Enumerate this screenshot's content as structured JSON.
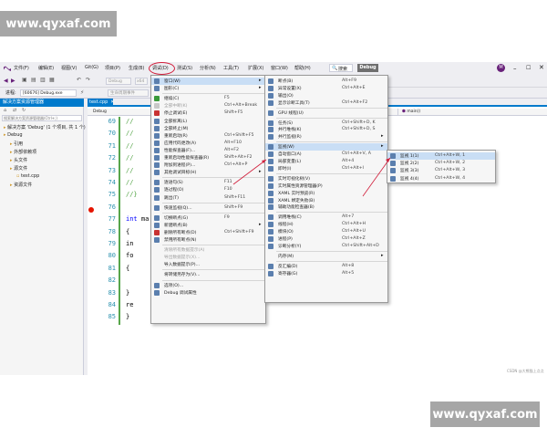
{
  "watermark": {
    "text": "www.qyxaf.com"
  },
  "menubar": {
    "items": [
      "文件(F)",
      "编辑(E)",
      "视图(V)",
      "Git(G)",
      "项目(P)",
      "生成(B)",
      "调试(D)",
      "测试(S)",
      "分析(N)",
      "工具(T)",
      "扩展(X)",
      "窗口(W)",
      "帮助(H)"
    ],
    "search_label": "搜索",
    "solution_badge": "Debug",
    "avatar_letter": "M",
    "live_share_label": "Live Share"
  },
  "toolbar": {
    "config": "Debug",
    "platform": "x64",
    "process_label": "进程:",
    "process_value": "[60676] Debug.exe",
    "lifecycle_label": "生命周期事件"
  },
  "solution_explorer": {
    "title": "解决方案资源管理器",
    "search_placeholder": "搜索解决方案资源管理器(Ctrl+;)",
    "items": [
      {
        "label": "解决方案 'Debug' (1 个项目, 共 1 个)",
        "level": 0
      },
      {
        "label": "Debug",
        "level": 0
      },
      {
        "label": "引用",
        "level": 1
      },
      {
        "label": "外部依赖项",
        "level": 1
      },
      {
        "label": "头文件",
        "level": 1
      },
      {
        "label": "源文件",
        "level": 1
      },
      {
        "label": "test.cpp",
        "level": 2
      },
      {
        "label": "资源文件",
        "level": 1
      }
    ]
  },
  "editor": {
    "tab": "test.cpp",
    "nav_project": "Debug",
    "nav_func": "main()",
    "lines": [
      {
        "no": "69",
        "code": "//"
      },
      {
        "no": "70",
        "code": "//"
      },
      {
        "no": "71",
        "code": "//"
      },
      {
        "no": "72",
        "code": "//"
      },
      {
        "no": "73",
        "code": "//"
      },
      {
        "no": "74",
        "code": "//"
      },
      {
        "no": "75",
        "code": "//}"
      },
      {
        "no": "76",
        "code": ""
      },
      {
        "no": "77",
        "code": "int ma"
      },
      {
        "no": "78",
        "code": "{"
      },
      {
        "no": "79",
        "code": "    in"
      },
      {
        "no": "80",
        "code": "    fo"
      },
      {
        "no": "81",
        "code": "    {"
      },
      {
        "no": "82",
        "code": ""
      },
      {
        "no": "83",
        "code": "    }"
      },
      {
        "no": "84",
        "code": "    re"
      },
      {
        "no": "85",
        "code": "}"
      }
    ]
  },
  "debug_menu": {
    "items": [
      {
        "label": "窗口(W)",
        "shortcut": "",
        "submenu": true,
        "selected": true,
        "icon": "window-icon"
      },
      {
        "label": "图形(C)",
        "shortcut": "",
        "submenu": true,
        "icon": "graphics-icon"
      },
      {
        "sep": true
      },
      {
        "label": "继续(C)",
        "shortcut": "F5",
        "icon": "continue-icon"
      },
      {
        "label": "全部中断(K)",
        "shortcut": "Ctrl+Alt+Break",
        "disabled": true,
        "icon": "pause-icon"
      },
      {
        "label": "停止调试(E)",
        "shortcut": "Shift+F5",
        "icon": "stop-icon"
      },
      {
        "label": "全部拆离(L)",
        "shortcut": "",
        "icon": "detach-icon"
      },
      {
        "label": "全部终止(M)",
        "shortcut": "",
        "icon": "terminate-icon"
      },
      {
        "label": "重新启动(R)",
        "shortcut": "Ctrl+Shift+F5",
        "icon": "restart-icon"
      },
      {
        "label": "应用代码更改(A)",
        "shortcut": "Alt+F10",
        "icon": "hot-reload-icon"
      },
      {
        "label": "性能探查器(F)...",
        "shortcut": "Alt+F2",
        "icon": "profiler-icon"
      },
      {
        "label": "重新启动性能探查器(R)",
        "shortcut": "Shift+Alt+F2",
        "icon": "profiler-restart-icon"
      },
      {
        "label": "附加到进程(P)...",
        "shortcut": "Ctrl+Alt+P",
        "icon": "attach-icon"
      },
      {
        "label": "其他调试目标(H)",
        "shortcut": "",
        "submenu": true,
        "icon": "target-icon"
      },
      {
        "sep": true
      },
      {
        "label": "逐语句(S)",
        "shortcut": "F11",
        "icon": "step-into-icon"
      },
      {
        "label": "逐过程(O)",
        "shortcut": "F10",
        "icon": "step-over-icon"
      },
      {
        "label": "跳出(T)",
        "shortcut": "Shift+F11",
        "icon": "step-out-icon"
      },
      {
        "sep": true
      },
      {
        "label": "快速监视(Q)...",
        "shortcut": "Shift+F9",
        "icon": "quickwatch-icon"
      },
      {
        "sep": true
      },
      {
        "label": "切换断点(G)",
        "shortcut": "F9",
        "icon": "toggle-breakpoint-icon"
      },
      {
        "label": "新建断点(B)",
        "shortcut": "",
        "submenu": true,
        "icon": "new-breakpoint-icon"
      },
      {
        "label": "删除所有断点(D)",
        "shortcut": "Ctrl+Shift+F9",
        "icon": "delete-breakpoints-icon"
      },
      {
        "label": "禁用所有断点(N)",
        "shortcut": "",
        "icon": "disable-breakpoints-icon"
      },
      {
        "sep": true
      },
      {
        "label": "清除所有数据提示(A)",
        "shortcut": "",
        "disabled": true,
        "icon": "blank-icon"
      },
      {
        "label": "导出数据提示(X)...",
        "shortcut": "",
        "disabled": true,
        "icon": "blank-icon"
      },
      {
        "label": "导入数据提示(P)...",
        "shortcut": "",
        "icon": "blank-icon"
      },
      {
        "sep": true
      },
      {
        "label": "将转储另存为(V)...",
        "shortcut": "",
        "icon": "blank-icon"
      },
      {
        "sep": true
      },
      {
        "label": "选项(O)...",
        "shortcut": "",
        "icon": "gear-icon"
      },
      {
        "label": "Debug 调试属性",
        "shortcut": "",
        "icon": "wrench-icon"
      }
    ]
  },
  "windows_menu": {
    "items": [
      {
        "label": "断点(B)",
        "shortcut": "Alt+F9",
        "icon": "breakpoint-window-icon"
      },
      {
        "label": "异常设置(X)",
        "shortcut": "Ctrl+Alt+E",
        "icon": "exception-icon"
      },
      {
        "label": "输出(O)",
        "shortcut": "",
        "icon": "output-icon"
      },
      {
        "label": "显示诊断工具(T)",
        "shortcut": "Ctrl+Alt+F2",
        "icon": "diagnostics-icon"
      },
      {
        "sep": true
      },
      {
        "label": "GPU 线程(U)",
        "shortcut": "",
        "icon": "gpu-icon"
      },
      {
        "sep": true
      },
      {
        "label": "任务(S)",
        "shortcut": "Ctrl+Shift+D, K",
        "icon": "tasks-icon"
      },
      {
        "label": "并行堆栈(K)",
        "shortcut": "Ctrl+Shift+D, S",
        "icon": "parallel-stacks-icon"
      },
      {
        "label": "并行监视(R)",
        "shortcut": "",
        "submenu": true,
        "icon": "parallel-watch-icon"
      },
      {
        "sep": true
      },
      {
        "label": "监视(W)",
        "shortcut": "",
        "submenu": true,
        "selected": true,
        "icon": "watch-icon"
      },
      {
        "label": "自动窗口(A)",
        "shortcut": "Ctrl+Alt+V, A",
        "icon": "autos-icon"
      },
      {
        "label": "局部变量(L)",
        "shortcut": "Alt+4",
        "icon": "locals-icon"
      },
      {
        "label": "即时(I)",
        "shortcut": "Ctrl+Alt+I",
        "icon": "immediate-icon"
      },
      {
        "sep": true
      },
      {
        "label": "实时可视化树(V)",
        "shortcut": "",
        "icon": "visual-tree-icon"
      },
      {
        "label": "实时属性资源管理器(P)",
        "shortcut": "",
        "icon": "property-explorer-icon"
      },
      {
        "label": "XAML 实时预览(R)",
        "shortcut": "",
        "icon": "xaml-preview-icon"
      },
      {
        "label": "XAML 绑定失败(B)",
        "shortcut": "",
        "icon": "xaml-binding-icon"
      },
      {
        "label": "辅助功能检查器(B)",
        "shortcut": "",
        "icon": "accessibility-icon"
      },
      {
        "sep": true
      },
      {
        "label": "调用堆栈(C)",
        "shortcut": "Alt+7",
        "icon": "call-stack-icon"
      },
      {
        "label": "线程(H)",
        "shortcut": "Ctrl+Alt+H",
        "icon": "threads-icon"
      },
      {
        "label": "模块(O)",
        "shortcut": "Ctrl+Alt+U",
        "icon": "modules-icon"
      },
      {
        "label": "进程(P)",
        "shortcut": "Ctrl+Alt+Z",
        "icon": "processes-icon"
      },
      {
        "label": "诊断分析(Y)",
        "shortcut": "Ctrl+Shift+Alt+D",
        "icon": "analysis-icon"
      },
      {
        "sep": true
      },
      {
        "label": "内存(M)",
        "shortcut": "",
        "submenu": true,
        "icon": "blank-icon"
      },
      {
        "sep": true
      },
      {
        "label": "反汇编(D)",
        "shortcut": "Alt+8",
        "icon": "disassembly-icon"
      },
      {
        "label": "寄存器(G)",
        "shortcut": "Alt+5",
        "icon": "registers-icon"
      }
    ]
  },
  "watch_menu": {
    "items": [
      {
        "label": "监视 1(1)",
        "shortcut": "Ctrl+Alt+W, 1",
        "selected": true,
        "icon": "watch-1-icon"
      },
      {
        "label": "监视 2(2)",
        "shortcut": "Ctrl+Alt+W, 2",
        "icon": "watch-2-icon"
      },
      {
        "label": "监视 3(3)",
        "shortcut": "Ctrl+Alt+W, 3",
        "icon": "watch-3-icon"
      },
      {
        "label": "监视 4(4)",
        "shortcut": "Ctrl+Alt+W, 4",
        "icon": "watch-4-icon"
      }
    ]
  },
  "credit": "CSDN @大熊猫上点点",
  "colors": {
    "accent": "#007acc",
    "annotation": "#d21f3c",
    "menu_selected": "#c9def5",
    "vs_purple": "#68217a"
  }
}
